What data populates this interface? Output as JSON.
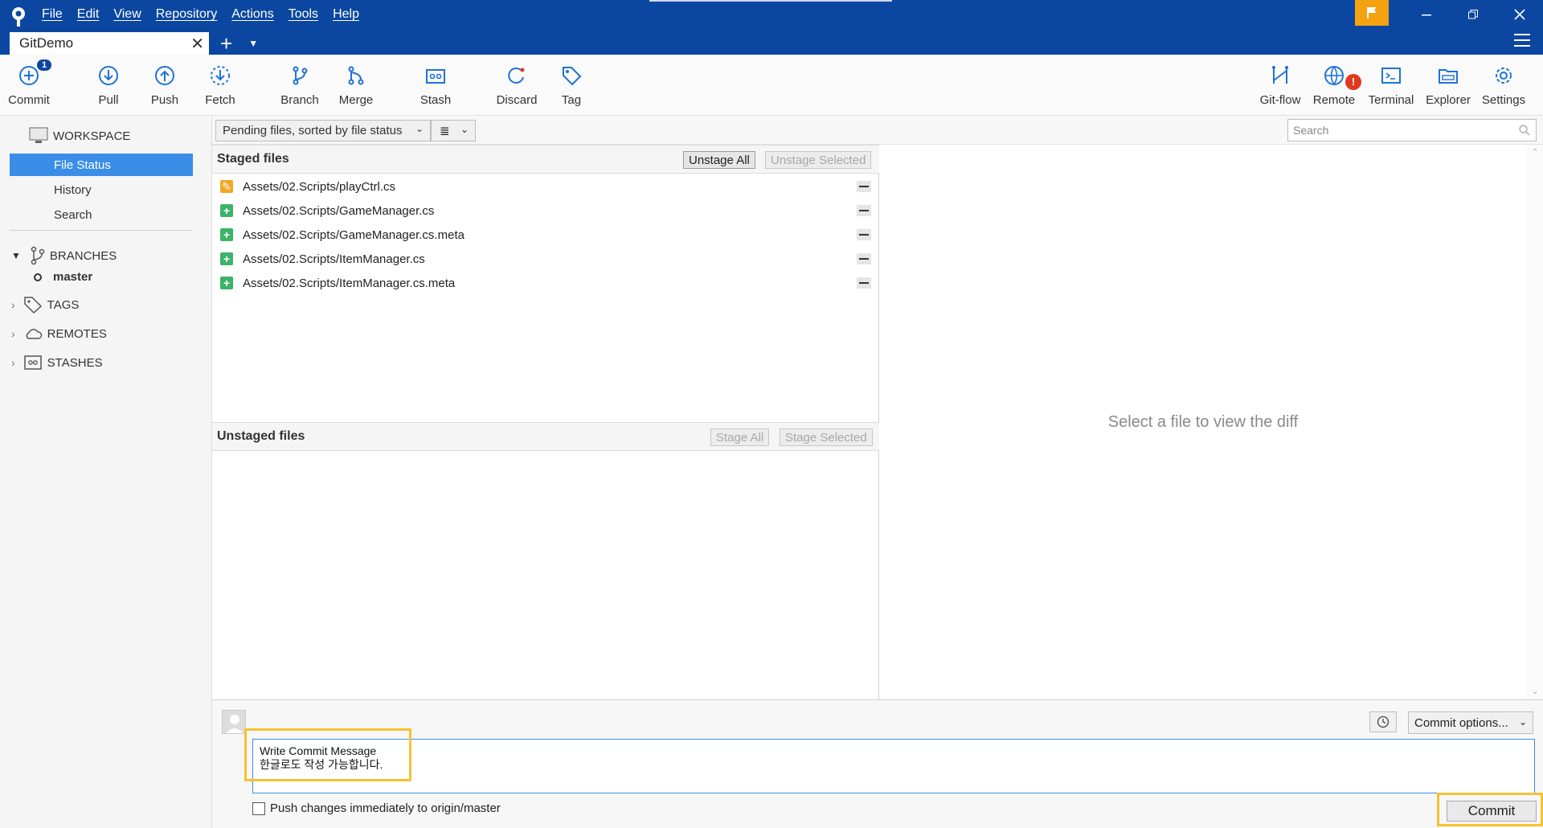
{
  "menu": [
    "File",
    "Edit",
    "View",
    "Repository",
    "Actions",
    "Tools",
    "Help"
  ],
  "tab": {
    "title": "GitDemo"
  },
  "toolbar": {
    "commit": "Commit",
    "commit_badge": "1",
    "pull": "Pull",
    "push": "Push",
    "fetch": "Fetch",
    "branch": "Branch",
    "merge": "Merge",
    "stash": "Stash",
    "discard": "Discard",
    "tag": "Tag",
    "gitflow": "Git-flow",
    "remote": "Remote",
    "terminal": "Terminal",
    "explorer": "Explorer",
    "settings": "Settings"
  },
  "sidebar": {
    "workspace": "WORKSPACE",
    "items": [
      "File Status",
      "History",
      "Search"
    ],
    "branches": "BRANCHES",
    "current_branch": "master",
    "tags": "TAGS",
    "remotes": "REMOTES",
    "stashes": "STASHES"
  },
  "filter": {
    "sort": "Pending files, sorted by file status",
    "view_icon": "≣",
    "search_placeholder": "Search"
  },
  "staged": {
    "title": "Staged files",
    "unstage_all": "Unstage All",
    "unstage_selected": "Unstage Selected",
    "files": [
      {
        "path": "Assets/02.Scripts/playCtrl.cs",
        "status": "modified"
      },
      {
        "path": "Assets/02.Scripts/GameManager.cs",
        "status": "added"
      },
      {
        "path": "Assets/02.Scripts/GameManager.cs.meta",
        "status": "added"
      },
      {
        "path": "Assets/02.Scripts/ItemManager.cs",
        "status": "added"
      },
      {
        "path": "Assets/02.Scripts/ItemManager.cs.meta",
        "status": "added"
      }
    ]
  },
  "unstaged": {
    "title": "Unstaged files",
    "stage_all": "Stage All",
    "stage_selected": "Stage Selected"
  },
  "diff": {
    "placeholder": "Select a file to view the diff"
  },
  "commit": {
    "message": "Write Commit Message\n한글로도 작성 가능합니다.",
    "options": "Commit options...",
    "push_label": "Push changes immediately to origin/master",
    "button": "Commit"
  },
  "colors": {
    "titlebar": "#0b47a0",
    "accent": "#3b8ee8",
    "highlight": "#f7c231",
    "added": "#3db26b",
    "modified": "#f5a623"
  }
}
